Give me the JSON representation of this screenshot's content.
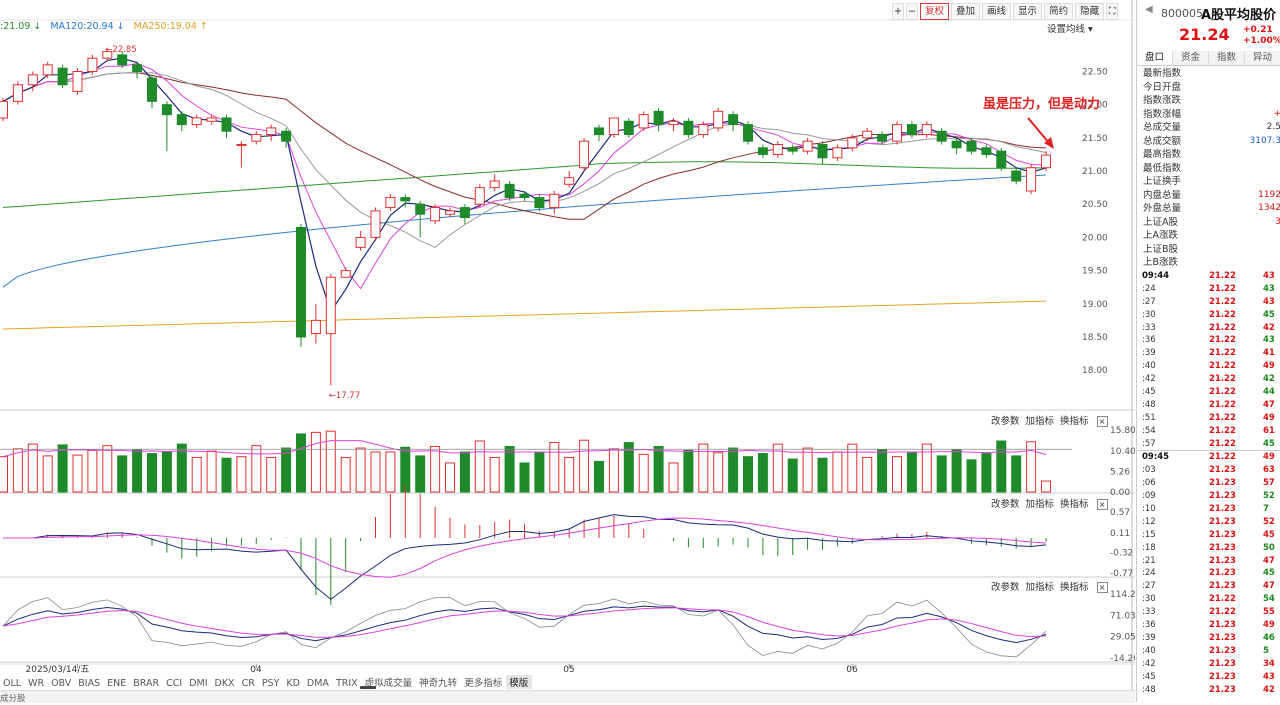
{
  "toolbar": {
    "plus": "+",
    "minus": "−",
    "fuquan": "复权",
    "diejia": "叠加",
    "huaxian": "画线",
    "xianshi": "显示",
    "jianyue": "简约",
    "yincang": "隐藏",
    "more": "▸▸",
    "expand": "⛶"
  },
  "ma_legend": [
    {
      "text": ":21.09 ↓",
      "color": "#2a8a2a"
    },
    {
      "text": "MA120:20.94 ↓",
      "color": "#2277cc"
    },
    {
      "text": "MA250:19.04 ↑",
      "color": "#e0a020"
    }
  ],
  "setting_ma": "设置均线 ▾",
  "annotation": "虽是压力，但是动力",
  "pane_tools": {
    "a": "改参数",
    "b": "加指标",
    "c": "换指标",
    "close": "×"
  },
  "bottom_tabs": [
    "OLL",
    "WR",
    "OBV",
    "BIAS",
    "ENE",
    "BRAR",
    "CCI",
    "DMI",
    "DKX",
    "CR",
    "PSY",
    "KD",
    "DMA",
    "TRIX",
    "虚拟成交量",
    "神奇九转",
    "更多指标",
    "模版"
  ],
  "status_left": "成分股",
  "chart_data": {
    "type": "candlestick",
    "x_labels": [
      {
        "label": "2025/03/14/五",
        "index": 5
      },
      {
        "label": "04",
        "index": 17
      },
      {
        "label": "05",
        "index": 38
      },
      {
        "label": "06",
        "index": 57
      }
    ],
    "price_axis": [
      "22.50",
      "22.00",
      "21.50",
      "21.00",
      "20.50",
      "20.00",
      "19.50",
      "19.00",
      "18.50",
      "18.00"
    ],
    "high_label": "22.85",
    "low_label": "17.77",
    "candles": [
      [
        21.8,
        22.05,
        21.75,
        22.1
      ],
      [
        22.05,
        22.3,
        22.0,
        22.35
      ],
      [
        22.3,
        22.45,
        22.2,
        22.5
      ],
      [
        22.45,
        22.6,
        22.4,
        22.65
      ],
      [
        22.55,
        22.3,
        22.25,
        22.6
      ],
      [
        22.2,
        22.5,
        22.15,
        22.55
      ],
      [
        22.5,
        22.7,
        22.45,
        22.75
      ],
      [
        22.7,
        22.8,
        22.65,
        22.85
      ],
      [
        22.75,
        22.6,
        22.55,
        22.8
      ],
      [
        22.6,
        22.5,
        22.4,
        22.65
      ],
      [
        22.4,
        22.05,
        21.95,
        22.45
      ],
      [
        22.0,
        21.85,
        21.3,
        22.05
      ],
      [
        21.85,
        21.7,
        21.6,
        21.9
      ],
      [
        21.7,
        21.8,
        21.65,
        21.85
      ],
      [
        21.75,
        21.8,
        21.7,
        21.85
      ],
      [
        21.8,
        21.6,
        21.5,
        21.85
      ],
      [
        21.4,
        21.4,
        21.05,
        21.45
      ],
      [
        21.45,
        21.55,
        21.4,
        21.6
      ],
      [
        21.55,
        21.65,
        21.45,
        21.7
      ],
      [
        21.6,
        21.45,
        21.35,
        21.65
      ],
      [
        20.15,
        18.5,
        18.35,
        20.2
      ],
      [
        18.55,
        18.75,
        18.4,
        19.0
      ],
      [
        18.55,
        19.4,
        17.77,
        19.45
      ],
      [
        19.4,
        19.5,
        19.4,
        19.55
      ],
      [
        19.85,
        20.0,
        19.8,
        20.1
      ],
      [
        20.0,
        20.4,
        19.95,
        20.45
      ],
      [
        20.45,
        20.6,
        20.4,
        20.65
      ],
      [
        20.6,
        20.55,
        20.45,
        20.65
      ],
      [
        20.5,
        20.35,
        20.0,
        20.55
      ],
      [
        20.25,
        20.45,
        20.2,
        20.5
      ],
      [
        20.35,
        20.4,
        20.3,
        20.45
      ],
      [
        20.45,
        20.3,
        20.2,
        20.5
      ],
      [
        20.5,
        20.75,
        20.45,
        20.8
      ],
      [
        20.75,
        20.85,
        20.7,
        20.95
      ],
      [
        20.8,
        20.6,
        20.55,
        20.85
      ],
      [
        20.65,
        20.6,
        20.55,
        20.7
      ],
      [
        20.6,
        20.45,
        20.4,
        20.65
      ],
      [
        20.45,
        20.65,
        20.35,
        20.7
      ],
      [
        20.8,
        20.9,
        20.75,
        21.0
      ],
      [
        21.05,
        21.45,
        21.0,
        21.5
      ],
      [
        21.65,
        21.55,
        21.45,
        21.7
      ],
      [
        21.55,
        21.8,
        21.5,
        21.8
      ],
      [
        21.75,
        21.55,
        21.5,
        21.8
      ],
      [
        21.65,
        21.85,
        21.6,
        21.9
      ],
      [
        21.9,
        21.7,
        21.6,
        21.95
      ],
      [
        21.7,
        21.75,
        21.6,
        21.8
      ],
      [
        21.75,
        21.55,
        21.5,
        21.8
      ],
      [
        21.55,
        21.7,
        21.5,
        21.75
      ],
      [
        21.65,
        21.9,
        21.6,
        21.95
      ],
      [
        21.85,
        21.7,
        21.6,
        21.9
      ],
      [
        21.7,
        21.45,
        21.4,
        21.75
      ],
      [
        21.35,
        21.25,
        21.2,
        21.4
      ],
      [
        21.25,
        21.4,
        21.2,
        21.45
      ],
      [
        21.35,
        21.3,
        21.25,
        21.4
      ],
      [
        21.3,
        21.45,
        21.25,
        21.5
      ],
      [
        21.4,
        21.2,
        21.1,
        21.45
      ],
      [
        21.2,
        21.35,
        21.15,
        21.4
      ],
      [
        21.35,
        21.5,
        21.3,
        21.55
      ],
      [
        21.5,
        21.6,
        21.45,
        21.65
      ],
      [
        21.55,
        21.45,
        21.4,
        21.6
      ],
      [
        21.45,
        21.7,
        21.4,
        21.75
      ],
      [
        21.7,
        21.55,
        21.5,
        21.75
      ],
      [
        21.55,
        21.7,
        21.5,
        21.75
      ],
      [
        21.6,
        21.45,
        21.4,
        21.65
      ],
      [
        21.45,
        21.35,
        21.25,
        21.5
      ],
      [
        21.45,
        21.3,
        21.25,
        21.5
      ],
      [
        21.35,
        21.25,
        21.2,
        21.4
      ],
      [
        21.3,
        21.05,
        21.0,
        21.35
      ],
      [
        21.0,
        20.85,
        20.8,
        21.05
      ],
      [
        20.7,
        21.05,
        20.65,
        21.1
      ],
      [
        21.05,
        21.24,
        21.0,
        21.3
      ]
    ],
    "volume_axis": [
      "15.80",
      "10.40",
      "5.26",
      "0.00"
    ],
    "macd_axis": [
      "0.57",
      "0.11",
      "-0.32",
      "-0.77"
    ],
    "kdj_axis": [
      "114.28",
      "71.03",
      "29.05",
      "-14.20"
    ]
  },
  "quote": {
    "code": "800005",
    "name": "A股平均股价",
    "price": "21.24",
    "change": "+0.21",
    "change_pct": "+1.00%",
    "tabs": [
      "盘口",
      "资金",
      "指数",
      "异动"
    ],
    "stats": [
      {
        "label": "最新指数",
        "value": "",
        "cls": "red"
      },
      {
        "label": "今日开盘",
        "value": "",
        "cls": "red"
      },
      {
        "label": "指数涨跌",
        "value": "",
        "cls": "red"
      },
      {
        "label": "指数涨幅",
        "value": "+",
        "cls": "red"
      },
      {
        "label": "总成交量",
        "value": "2.5",
        "cls": ""
      },
      {
        "label": "总成交额",
        "value": "3107.3",
        "cls": "blue"
      },
      {
        "label": "最高指数",
        "value": "",
        "cls": "red"
      },
      {
        "label": "最低指数",
        "value": "",
        "cls": "red"
      },
      {
        "label": "上证换手",
        "value": "",
        "cls": ""
      },
      {
        "label": "内盘总量",
        "value": "1192",
        "cls": "red"
      },
      {
        "label": "外盘总量",
        "value": "1342",
        "cls": "red"
      },
      {
        "label": "上证A股",
        "value": "3",
        "cls": "red"
      },
      {
        "label": "上A涨跌",
        "value": "",
        "cls": "red"
      },
      {
        "label": "上证B股",
        "value": "",
        "cls": ""
      },
      {
        "label": "上B涨跌",
        "value": "",
        "cls": ""
      }
    ],
    "ticks": [
      {
        "t": "09:44",
        "p": "21.22",
        "q": "43",
        "bold": true
      },
      {
        "t": ":24",
        "p": "21.22",
        "q": "43"
      },
      {
        "t": ":27",
        "p": "21.22",
        "q": "43"
      },
      {
        "t": ":30",
        "p": "21.22",
        "q": "45"
      },
      {
        "t": ":33",
        "p": "21.22",
        "q": "42"
      },
      {
        "t": ":36",
        "p": "21.22",
        "q": "43"
      },
      {
        "t": ":39",
        "p": "21.22",
        "q": "41"
      },
      {
        "t": ":40",
        "p": "21.22",
        "q": "49"
      },
      {
        "t": ":42",
        "p": "21.22",
        "q": "42"
      },
      {
        "t": ":45",
        "p": "21.22",
        "q": "44"
      },
      {
        "t": ":48",
        "p": "21.22",
        "q": "47"
      },
      {
        "t": ":51",
        "p": "21.22",
        "q": "49"
      },
      {
        "t": ":54",
        "p": "21.22",
        "q": "61"
      },
      {
        "t": ":57",
        "p": "21.22",
        "q": "45"
      },
      {
        "t": "09:45",
        "p": "21.22",
        "q": "49",
        "bold": true,
        "sep": true
      },
      {
        "t": ":03",
        "p": "21.23",
        "q": "63"
      },
      {
        "t": ":06",
        "p": "21.23",
        "q": "57"
      },
      {
        "t": ":09",
        "p": "21.23",
        "q": "52"
      },
      {
        "t": ":10",
        "p": "21.23",
        "q": "7"
      },
      {
        "t": ":12",
        "p": "21.23",
        "q": "52"
      },
      {
        "t": ":15",
        "p": "21.23",
        "q": "45"
      },
      {
        "t": ":18",
        "p": "21.23",
        "q": "50"
      },
      {
        "t": ":21",
        "p": "21.23",
        "q": "47"
      },
      {
        "t": ":24",
        "p": "21.23",
        "q": "45"
      },
      {
        "t": ":27",
        "p": "21.23",
        "q": "47"
      },
      {
        "t": ":30",
        "p": "21.22",
        "q": "54"
      },
      {
        "t": ":33",
        "p": "21.22",
        "q": "55"
      },
      {
        "t": ":36",
        "p": "21.23",
        "q": "49"
      },
      {
        "t": ":39",
        "p": "21.23",
        "q": "46"
      },
      {
        "t": ":40",
        "p": "21.23",
        "q": "5"
      },
      {
        "t": ":42",
        "p": "21.23",
        "q": "34"
      },
      {
        "t": ":45",
        "p": "21.23",
        "q": "43"
      },
      {
        "t": ":48",
        "p": "21.23",
        "q": "42"
      }
    ]
  }
}
